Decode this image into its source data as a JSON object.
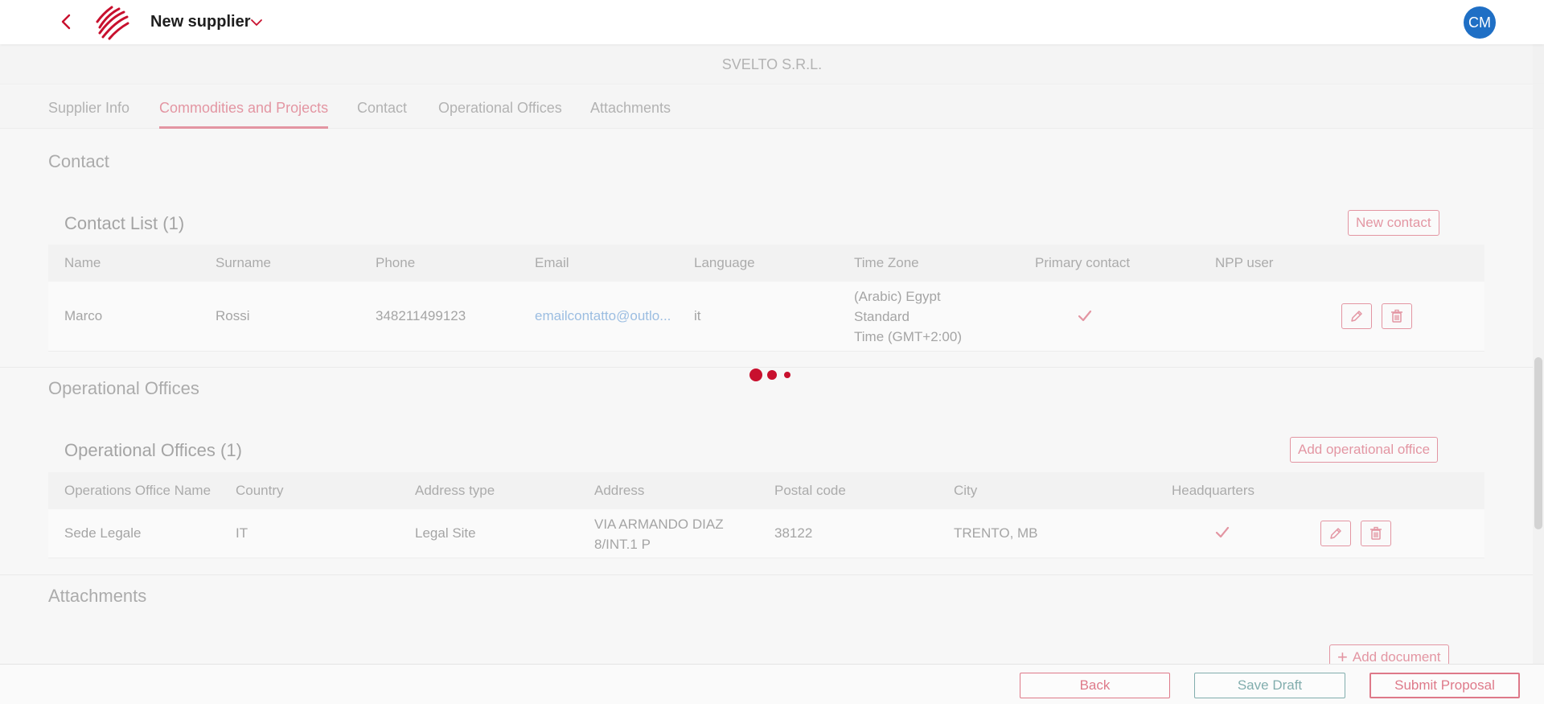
{
  "header": {
    "title": "New supplier",
    "back_icon": "chevron-left-icon",
    "logo": "company-logo",
    "dropdown_icon": "chevron-down-icon",
    "avatar_initials": "CM"
  },
  "company": {
    "name": "SVELTO S.R.L."
  },
  "tabs": [
    {
      "label": "Supplier Info",
      "active": false
    },
    {
      "label": "Commodities and Projects",
      "active": true
    },
    {
      "label": "Contact",
      "active": false
    },
    {
      "label": "Operational Offices",
      "active": false
    },
    {
      "label": "Attachments",
      "active": false
    }
  ],
  "contact_section": {
    "title": "Contact",
    "list_title": "Contact List (1)",
    "new_button": "New contact",
    "columns": [
      "Name",
      "Surname",
      "Phone",
      "Email",
      "Language",
      "Time Zone",
      "Primary contact",
      "NPP user"
    ],
    "rows": [
      {
        "name": "Marco",
        "surname": "Rossi",
        "phone": "348211499123",
        "email": "emailcontatto@outlo...",
        "language": "it",
        "time_zone_lines": [
          "(Arabic) Egypt",
          "Standard",
          "Time (GMT+2:00)"
        ],
        "primary_contact": true,
        "npp_user": false
      }
    ]
  },
  "offices_section": {
    "title": "Operational Offices",
    "list_title": "Operational Offices (1)",
    "add_button": "Add operational office",
    "columns": [
      "Operations Office Name",
      "Country",
      "Address type",
      "Address",
      "Postal code",
      "City",
      "Headquarters"
    ],
    "rows": [
      {
        "office_name": "Sede Legale",
        "country": "IT",
        "address_type": "Legal Site",
        "address_lines": [
          "VIA ARMANDO DIAZ",
          "8/INT.1 P"
        ],
        "postal_code": "38122",
        "city": "TRENTO, MB",
        "headquarters": true
      }
    ]
  },
  "attachments_section": {
    "title": "Attachments",
    "add_button": "Add document"
  },
  "footer": {
    "back": "Back",
    "save_draft": "Save Draft",
    "submit": "Submit Proposal"
  },
  "colors": {
    "accent": "#c8102e",
    "avatar": "#1f6fc5",
    "link": "#1f6fc5",
    "draft_button": "#1f6f6f"
  }
}
